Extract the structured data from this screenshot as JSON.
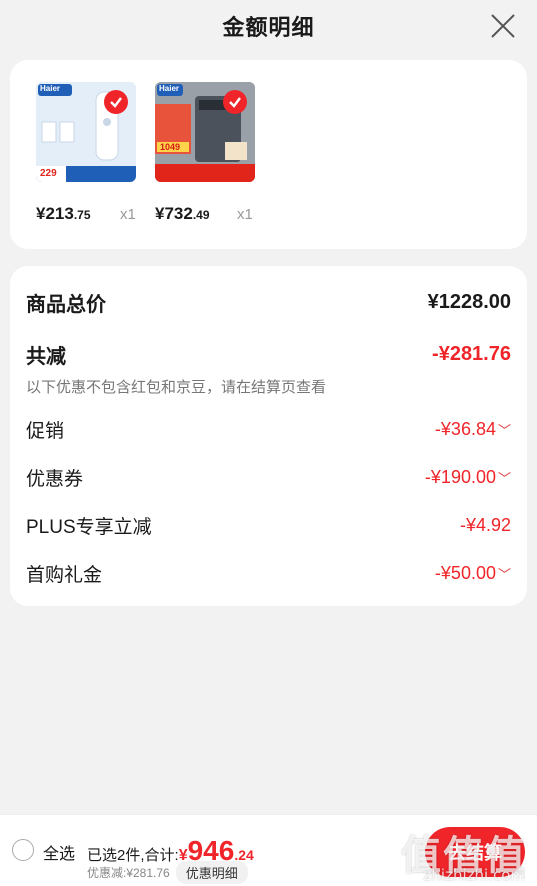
{
  "header": {
    "title": "金额明细"
  },
  "products": [
    {
      "price_int": "¥213",
      "price_dec": ".75",
      "qty": "x1",
      "brand": "Haier",
      "badge_price": "229",
      "colors": {
        "bg": "#dfeaf6",
        "band": "#1f5fb8"
      }
    },
    {
      "price_int": "¥732",
      "price_dec": ".49",
      "qty": "x1",
      "brand": "Haier",
      "badge_price": "1049",
      "colors": {
        "bg": "#8a8f98",
        "band": "#e1251b"
      }
    }
  ],
  "summary": {
    "total_label": "商品总价",
    "total_value": "¥1228.00",
    "reduce_label": "共减",
    "reduce_value": "-¥281.76",
    "note": "以下优惠不包含红包和京豆，请在结算页查看",
    "items": [
      {
        "label": "促销",
        "value": "-¥36.84",
        "expandable": true
      },
      {
        "label": "优惠券",
        "value": "-¥190.00",
        "expandable": true
      },
      {
        "label": "PLUS专享立减",
        "value": "-¥4.92",
        "expandable": false
      },
      {
        "label": "首购礼金",
        "value": "-¥50.00",
        "expandable": true
      }
    ]
  },
  "bottom": {
    "select_all": "全选",
    "selected_text": "已选2件,合计:",
    "total_symbol": "¥",
    "total_int": "946",
    "total_dec": ".24",
    "discount_text": "优惠减:¥281.76",
    "detail_label": "优惠明细",
    "checkout_label": "去结算",
    "watermark": "值值值",
    "watermark_url": "zhizhizhi.com"
  },
  "colors": {
    "accent": "#f0252a",
    "background": "#f2f2f2"
  }
}
